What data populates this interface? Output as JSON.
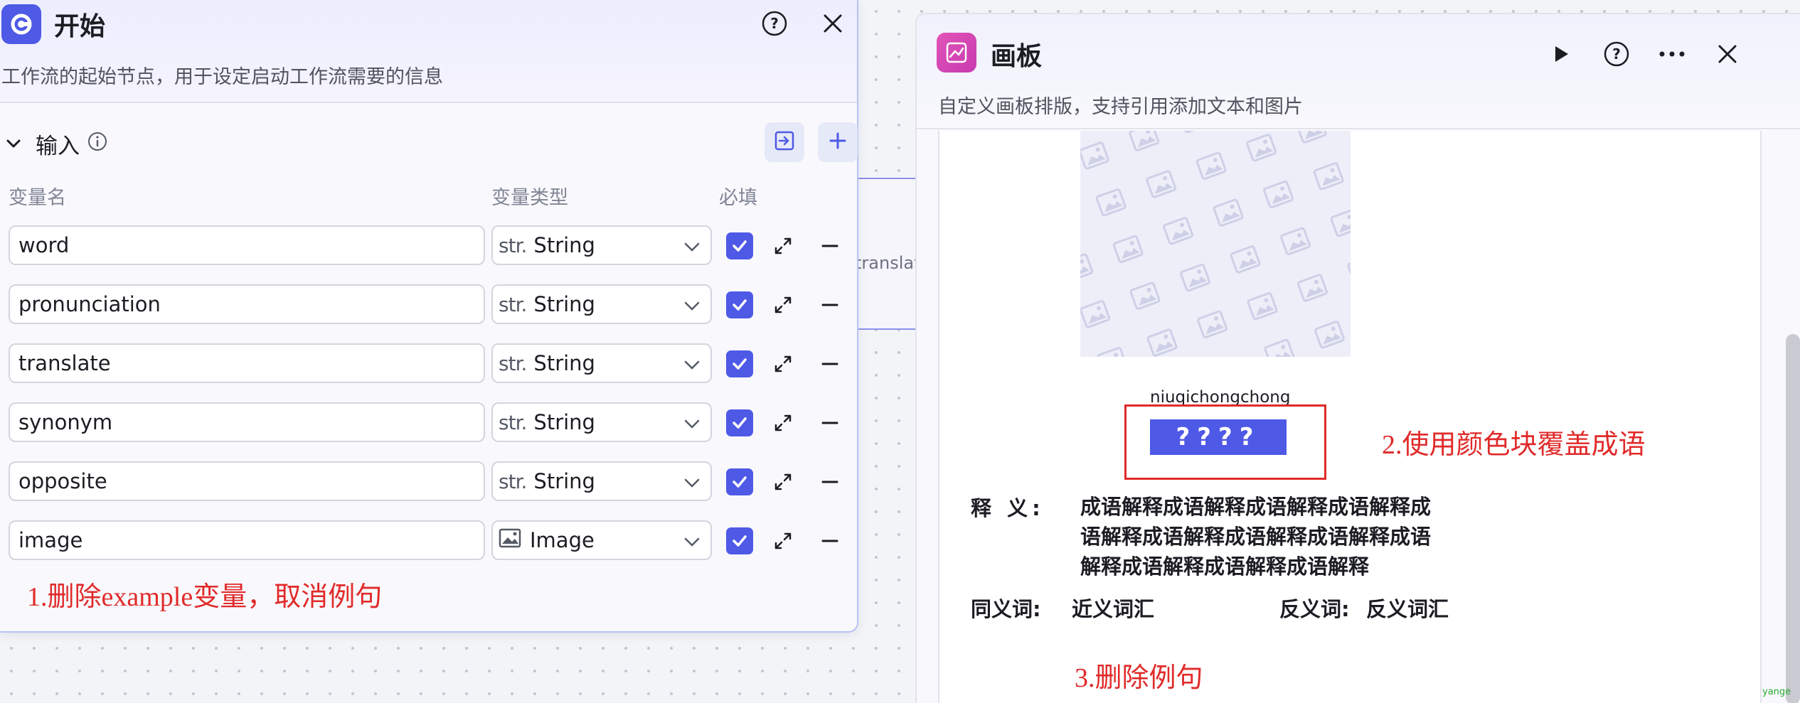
{
  "start_panel": {
    "title": "开始",
    "description": "工作流的起始节点，用于设定启动工作流需要的信息",
    "input_section": {
      "title": "输入",
      "columns": {
        "name": "变量名",
        "type": "变量类型",
        "required": "必填"
      },
      "rows": [
        {
          "name": "word",
          "type_prefix": "str.",
          "type": "String",
          "required": true
        },
        {
          "name": "pronunciation",
          "type_prefix": "str.",
          "type": "String",
          "required": true
        },
        {
          "name": "translate",
          "type_prefix": "str.",
          "type": "String",
          "required": true
        },
        {
          "name": "synonym",
          "type_prefix": "str.",
          "type": "String",
          "required": true
        },
        {
          "name": "opposite",
          "type_prefix": "str.",
          "type": "String",
          "required": true
        },
        {
          "name": "image",
          "type_prefix": "image-icon",
          "type": "Image",
          "required": true
        }
      ]
    },
    "annotation": "1.删除example变量，取消例句"
  },
  "canvas": {
    "background_node_text": "translat"
  },
  "board_panel": {
    "title": "画板",
    "description": "自定义画板排版，支持引用添加文本和图片",
    "preview": {
      "pinyin": "niuqichongchong",
      "masked_text": "????",
      "annotation_2": "2.使用颜色块覆盖成语",
      "definition_label": "释 义:",
      "definition_text": "成语解释成语解释成语解释成语解释成语解释成语解释成语解释成语解释成语解释成语解释成语解释成语解释",
      "synonym_label": "同义词:",
      "synonym_value": "近义词汇",
      "antonym_label": "反义词:",
      "antonym_value": "反义词汇",
      "annotation_3": "3.删除例句"
    }
  },
  "watermark": "yange",
  "colors": {
    "accent": "#4e59e6",
    "annotation_red": "#e12a2a",
    "board_logo": "#d04ab4"
  }
}
